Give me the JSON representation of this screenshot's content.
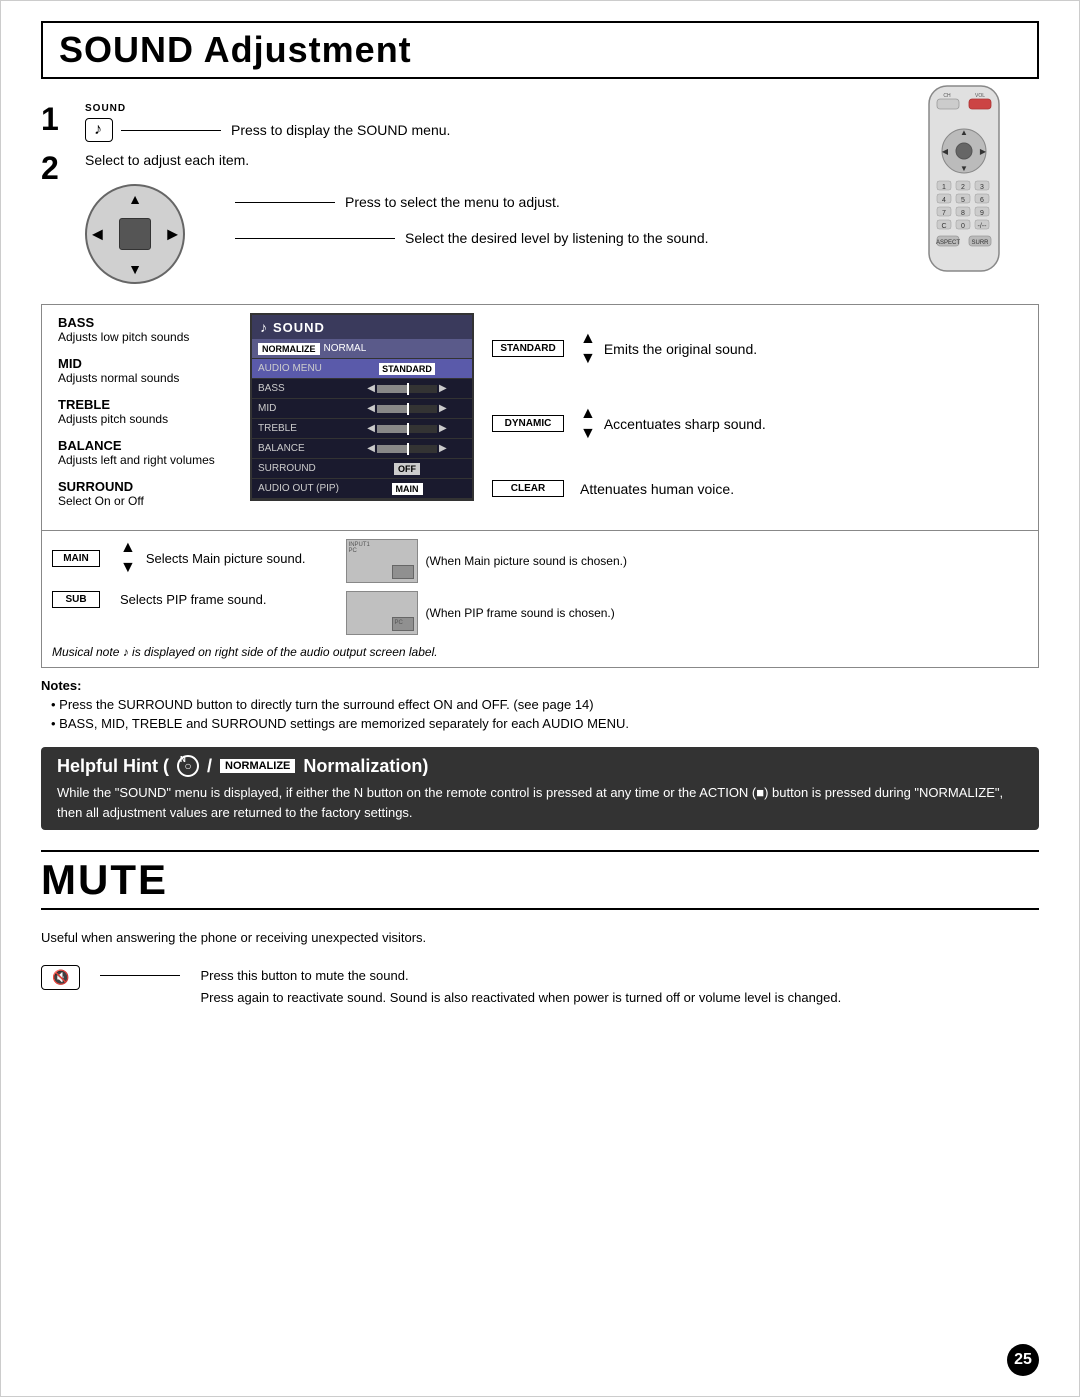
{
  "page": {
    "title": "SOUND Adjustment",
    "page_number": "25"
  },
  "step1": {
    "number": "1",
    "sound_label": "SOUND",
    "button_note": "♪",
    "instruction": "Press to display the SOUND menu."
  },
  "step2": {
    "number": "2",
    "instruction": "Select to adjust each item.",
    "press_instruction": "Press to select the menu to adjust.",
    "select_instruction": "Select the desired level by listening to the sound."
  },
  "labels": {
    "bass_title": "BASS",
    "bass_desc": "Adjusts low pitch sounds",
    "mid_title": "MID",
    "mid_desc": "Adjusts normal sounds",
    "treble_title": "TREBLE",
    "treble_desc": "Adjusts pitch sounds",
    "balance_title": "BALANCE",
    "balance_desc": "Adjusts left and right volumes",
    "surround_title": "SURROUND",
    "surround_desc": "Select On or Off"
  },
  "menu": {
    "title": "SOUND",
    "note_icon": "♪",
    "normalize_label": "NORMALIZE",
    "normalize_value": "NORMAL",
    "rows": [
      {
        "label": "AUDIO MENU",
        "value": "STANDARD",
        "type": "tag"
      },
      {
        "label": "BASS",
        "value": "0",
        "type": "slider"
      },
      {
        "label": "MID",
        "value": "0",
        "type": "slider"
      },
      {
        "label": "TREBLE",
        "value": "0",
        "type": "slider"
      },
      {
        "label": "BALANCE",
        "value": "0",
        "type": "slider"
      },
      {
        "label": "SURROUND",
        "value": "OFF",
        "type": "tag-off"
      },
      {
        "label": "AUDIO OUT (PIP)",
        "value": "MAIN",
        "type": "tag-main"
      }
    ]
  },
  "right_modes": {
    "standard_tag": "STANDARD",
    "standard_desc": "Emits the original sound.",
    "dynamic_tag": "DYNAMIC",
    "dynamic_desc": "Accentuates sharp sound.",
    "clear_tag": "CLEAR",
    "clear_desc": "Attenuates human voice."
  },
  "audio_out": {
    "main_tag": "MAIN",
    "main_desc": "Selects Main picture sound.",
    "sub_tag": "SUB",
    "sub_desc": "Selects PIP frame sound.",
    "pip_main_note": "(When Main picture sound is chosen.)",
    "pip_sub_note": "(When PIP frame sound is chosen.)"
  },
  "musical_note_text": "Musical note ♪ is displayed on right side of the audio output screen label.",
  "notes": {
    "title": "Notes:",
    "items": [
      "Press the SURROUND button to directly turn the surround effect ON and OFF. (see page 14)",
      "BASS, MID, TREBLE and SURROUND settings are memorized separately for each AUDIO MENU."
    ]
  },
  "helpful_hint": {
    "title_prefix": "Helpful Hint (",
    "n_label": "N",
    "title_middle": " / ",
    "normalize_tag": "NORMALIZE",
    "title_suffix": " Normalization)",
    "body": "While the \"SOUND\" menu is displayed, if either the N button on the remote control is pressed at any time or the ACTION (■) button is pressed during \"NORMALIZE\", then all adjustment values are returned to the factory settings."
  },
  "mute": {
    "title": "MUTE",
    "desc": "Useful when answering the phone or receiving unexpected visitors.",
    "button_icon": "🔇",
    "press_instruction": "Press this button to mute the sound.",
    "press_again_instruction": "Press again to reactivate sound. Sound is also reactivated when power is turned off or volume level is changed."
  }
}
